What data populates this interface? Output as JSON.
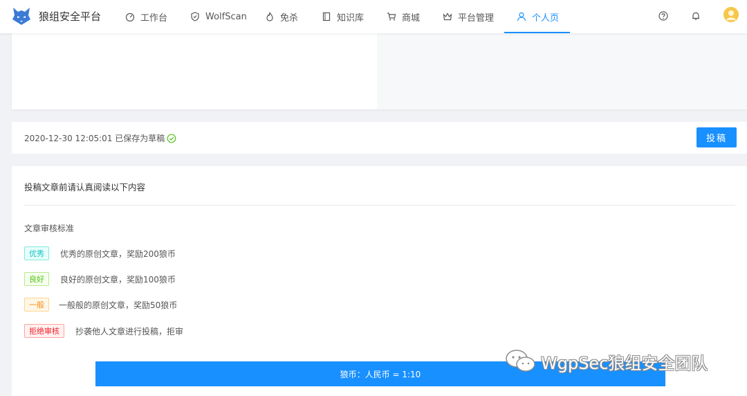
{
  "brand": {
    "name": "狼组安全平台",
    "logo_icon": "wolf-logo-icon"
  },
  "nav": {
    "items": [
      {
        "label": "工作台",
        "icon": "dashboard-icon"
      },
      {
        "label": "WolfScan",
        "icon": "shield-icon"
      },
      {
        "label": "免杀",
        "icon": "flame-icon"
      },
      {
        "label": "知识库",
        "icon": "book-icon"
      },
      {
        "label": "商城",
        "icon": "cart-icon"
      },
      {
        "label": "平台管理",
        "icon": "crown-icon"
      },
      {
        "label": "个人页",
        "icon": "user-icon"
      }
    ],
    "active_label": "个人页",
    "tools": [
      "help-icon",
      "bell-icon",
      "avatar"
    ]
  },
  "save": {
    "status_text": "2020-12-30 12:05:01 已保存为草稿",
    "submit_label": "投稿"
  },
  "rules": {
    "title": "投稿文章前请认真阅读以下内容",
    "standard_label": "文章审核标准",
    "items": [
      {
        "tag": "优秀",
        "text": "优秀的原创文章，奖励200狼币",
        "tag_color": "#13c2c2",
        "tag_bg": "#e6fffb",
        "tag_border": "#87e8de"
      },
      {
        "tag": "良好",
        "text": "良好的原创文章，奖励100狼币",
        "tag_color": "#52c41a",
        "tag_bg": "#f6ffed",
        "tag_border": "#b7eb8f"
      },
      {
        "tag": "一般",
        "text": "一般般的原创文章，奖励50狼币",
        "tag_color": "#fa8c16",
        "tag_bg": "#fff7e6",
        "tag_border": "#ffd591"
      },
      {
        "tag": "拒绝审核",
        "text": "抄袭他人文章进行投稿，拒审",
        "tag_color": "#f5222d",
        "tag_bg": "#fff1f0",
        "tag_border": "#ffa39e"
      }
    ],
    "rate_text": "狼币：人民币 = 1:10"
  },
  "watermark": {
    "text": "WgpSec狼组安全团队"
  },
  "colors": {
    "accent": "#1890ff",
    "success": "#52c41a"
  }
}
